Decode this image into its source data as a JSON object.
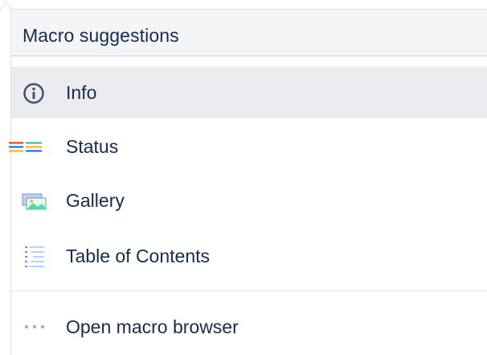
{
  "dropdown": {
    "header_title": "Macro suggestions",
    "items": [
      {
        "label": "Info",
        "icon": "info-icon",
        "selected": true
      },
      {
        "label": "Status",
        "icon": "status-icon",
        "selected": false
      },
      {
        "label": "Gallery",
        "icon": "gallery-icon",
        "selected": false
      },
      {
        "label": "Table of Contents",
        "icon": "table-of-contents-icon",
        "selected": false
      }
    ],
    "footer_item": {
      "label": "Open macro browser",
      "icon": "more-icon"
    }
  },
  "colors": {
    "header_bg": "#f4f5f7",
    "selected_bg": "#ebecf0",
    "text": "#172b4d",
    "status_red": "#de350b",
    "status_yellow": "#ffab00",
    "status_green": "#36b37e",
    "status_blue": "#0065ff"
  }
}
